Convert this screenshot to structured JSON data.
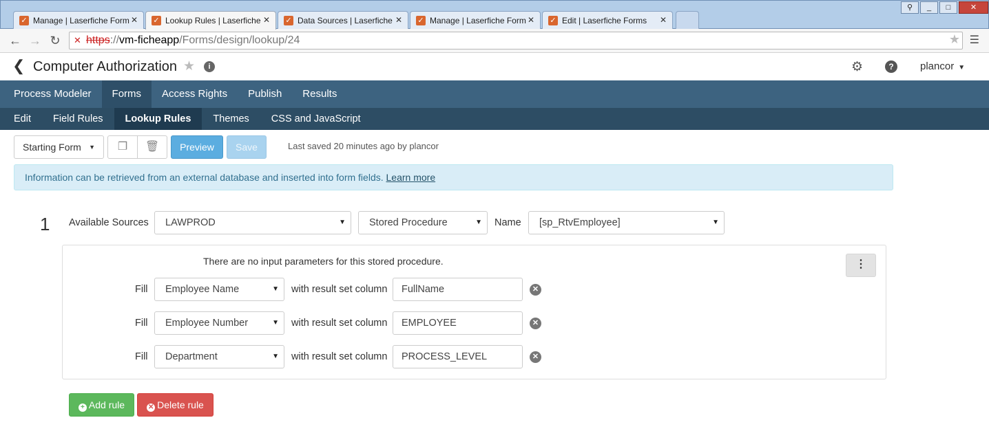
{
  "browser": {
    "tabs": [
      {
        "title": "Manage | Laserfiche Forms",
        "active": false
      },
      {
        "title": "Lookup Rules | Laserfiche Fo",
        "active": true
      },
      {
        "title": "Data Sources | Laserfiche Fo",
        "active": false
      },
      {
        "title": "Manage | Laserfiche Forms",
        "active": false
      },
      {
        "title": "Edit | Laserfiche Forms",
        "active": false
      }
    ],
    "url": {
      "protocol": "https",
      "sep": "://",
      "host": "vm-ficheapp",
      "path": "/Forms/design/lookup/24"
    }
  },
  "header": {
    "title": "Computer Authorization",
    "user": "plancor"
  },
  "nav_primary": [
    "Process Modeler",
    "Forms",
    "Access Rights",
    "Publish",
    "Results"
  ],
  "nav_primary_active": "Forms",
  "nav_secondary": [
    "Edit",
    "Field Rules",
    "Lookup Rules",
    "Themes",
    "CSS and JavaScript"
  ],
  "nav_secondary_active": "Lookup Rules",
  "actions": {
    "form_select": "Starting Form",
    "preview": "Preview",
    "save": "Save",
    "last_saved": "Last saved 20 minutes ago by plancor"
  },
  "info": {
    "text": "Information can be retrieved from an external database and inserted into form fields.",
    "link": "Learn more"
  },
  "rule": {
    "number": "1",
    "sources_label": "Available Sources",
    "source": "LAWPROD",
    "type": "Stored Procedure",
    "name_label": "Name",
    "name": "[sp_RtvEmployee]",
    "no_params": "There are no input parameters for this stored procedure.",
    "fill_label": "Fill",
    "with_label": "with result set column",
    "fills": [
      {
        "field": "Employee Name",
        "column": "FullName"
      },
      {
        "field": "Employee Number",
        "column": "EMPLOYEE"
      },
      {
        "field": "Department",
        "column": "PROCESS_LEVEL"
      }
    ]
  },
  "buttons": {
    "add": "Add rule",
    "delete": "Delete rule"
  },
  "colors": {
    "nav_primary": "#3d6380",
    "nav_secondary": "#2d4d64",
    "accent": "#5bade0",
    "success": "#5cb85c",
    "danger": "#d9534f"
  }
}
